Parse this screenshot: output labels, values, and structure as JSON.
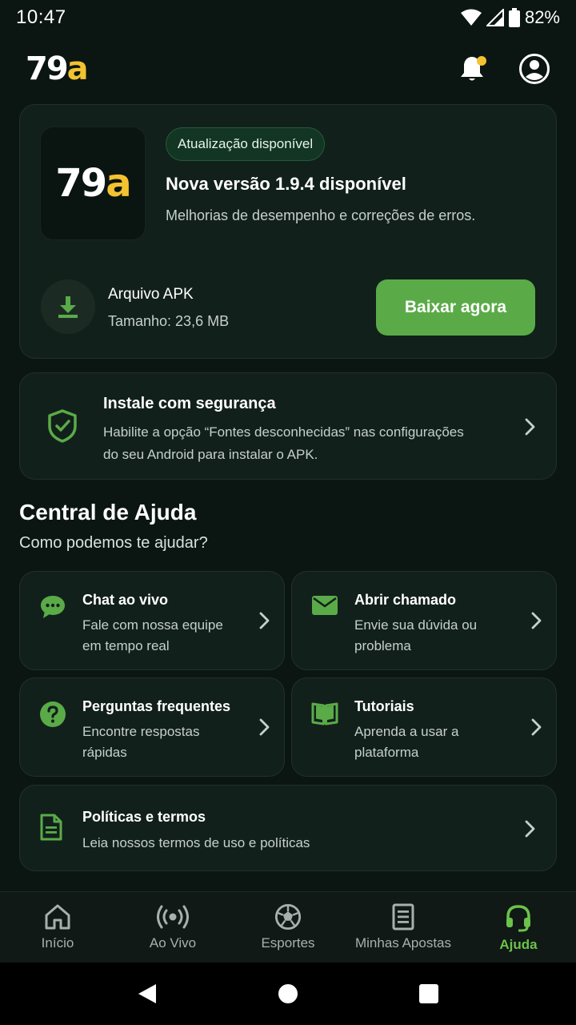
{
  "status_bar": {
    "time": "10:47",
    "battery": "82%"
  },
  "header": {
    "logo_main": "79",
    "logo_accent": "a"
  },
  "update_card": {
    "badge": "Atualização disponível",
    "title": "Nova versão 1.9.4 disponível",
    "description": "Melhorias de desempenho e correções de erros.",
    "file_label": "Arquivo APK",
    "file_size": "Tamanho: 23,6 MB",
    "download_label": "Baixar agora"
  },
  "safety_card": {
    "title": "Instale com segurança",
    "description": "Habilite a opção “Fontes desconhecidas” nas configurações do seu Android para instalar o APK."
  },
  "help": {
    "title": "Central de Ajuda",
    "subtitle": "Como podemos te ajudar?",
    "tiles": [
      {
        "title": "Chat ao vivo",
        "description": "Fale com nossa equipe em tempo real",
        "icon": "chat-bubble-icon"
      },
      {
        "title": "Abrir chamado",
        "description": "Envie sua dúvida ou problema",
        "icon": "envelope-icon"
      },
      {
        "title": "Perguntas frequentes",
        "description": "Encontre respostas rápidas",
        "icon": "question-circle-icon"
      },
      {
        "title": "Tutoriais",
        "description": "Aprenda a usar a plataforma",
        "icon": "open-book-icon"
      }
    ],
    "policies": {
      "title": "Políticas e termos",
      "description": "Leia nossos termos de uso e políticas",
      "icon": "document-icon"
    }
  },
  "bottom_nav": {
    "items": [
      {
        "label": "Início",
        "icon": "home-icon"
      },
      {
        "label": "Ao Vivo",
        "icon": "live-broadcast-icon"
      },
      {
        "label": "Esportes",
        "icon": "soccer-ball-icon"
      },
      {
        "label": "Minhas Apostas",
        "icon": "bet-slip-icon"
      },
      {
        "label": "Ajuda",
        "icon": "headset-icon"
      }
    ],
    "active": "Ajuda"
  },
  "colors": {
    "background": "#0b1612",
    "card": "#12201b",
    "accent_green": "#5aab48",
    "nav_active": "#6cc24a",
    "logo_yellow": "#f2c230"
  }
}
